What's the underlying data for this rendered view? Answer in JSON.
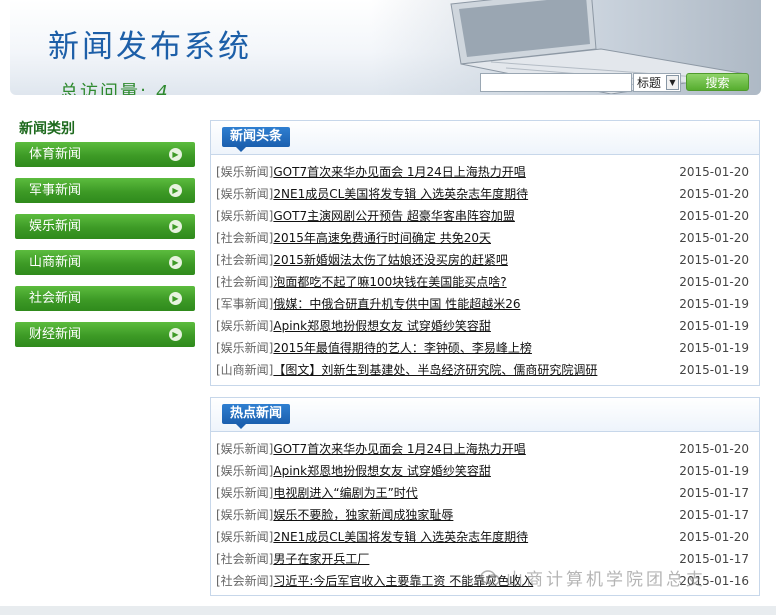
{
  "header": {
    "site_title": "新闻发布系统",
    "visit_label": "总访问量:",
    "visit_count": "4",
    "search_placeholder": "",
    "search_option": "标题",
    "search_button": "搜索"
  },
  "sidebar": {
    "title": "新闻类别",
    "items": [
      {
        "label": "体育新闻"
      },
      {
        "label": "军事新闻"
      },
      {
        "label": "娱乐新闻"
      },
      {
        "label": "山商新闻"
      },
      {
        "label": "社会新闻"
      },
      {
        "label": "财经新闻"
      }
    ]
  },
  "headlines": {
    "title": "新闻头条",
    "rows": [
      {
        "cat": "[娱乐新闻]",
        "title": "GOT7首次来华办见面会 1月24日上海热力开唱",
        "date": "2015-01-20"
      },
      {
        "cat": "[娱乐新闻]",
        "title": "2NE1成员CL美国将发专辑 入选英杂志年度期待",
        "date": "2015-01-20"
      },
      {
        "cat": "[娱乐新闻]",
        "title": "GOT7主演网剧公开预告 超豪华客串阵容加盟",
        "date": "2015-01-20"
      },
      {
        "cat": "[社会新闻]",
        "title": "2015年高速免费通行时间确定 共免20天",
        "date": "2015-01-20"
      },
      {
        "cat": "[社会新闻]",
        "title": "2015新婚姻法太伤了姑娘还没买房的赶紧吧",
        "date": "2015-01-20"
      },
      {
        "cat": "[社会新闻]",
        "title": "泡面都吃不起了嘛100块钱在美国能买点啥?",
        "date": "2015-01-20"
      },
      {
        "cat": "[军事新闻]",
        "title": "俄媒：中俄合研直升机专供中国 性能超越米26",
        "date": "2015-01-19"
      },
      {
        "cat": "[娱乐新闻]",
        "title": "Apink郑恩地扮假想女友 试穿婚纱笑容甜",
        "date": "2015-01-19"
      },
      {
        "cat": "[娱乐新闻]",
        "title": "2015年最值得期待的艺人：李钟硕、李易峰上榜",
        "date": "2015-01-19"
      },
      {
        "cat": "[山商新闻]",
        "title": "【图文】刘新生到基建处、半岛经济研究院、儒商研究院调研",
        "date": "2015-01-19"
      }
    ]
  },
  "hot": {
    "title": "热点新闻",
    "rows": [
      {
        "cat": "[娱乐新闻]",
        "title": "GOT7首次来华办见面会 1月24日上海热力开唱",
        "date": "2015-01-20"
      },
      {
        "cat": "[娱乐新闻]",
        "title": "Apink郑恩地扮假想女友 试穿婚纱笑容甜",
        "date": "2015-01-19"
      },
      {
        "cat": "[娱乐新闻]",
        "title": "电视剧进入“编剧为王”时代",
        "date": "2015-01-17"
      },
      {
        "cat": "[娱乐新闻]",
        "title": "娱乐不要脸，独家新闻成独家耻辱",
        "date": "2015-01-17"
      },
      {
        "cat": "[娱乐新闻]",
        "title": "2NE1成员CL美国将发专辑 入选英杂志年度期待",
        "date": "2015-01-20"
      },
      {
        "cat": "[社会新闻]",
        "title": "男子在家开兵工厂",
        "date": "2015-01-17"
      },
      {
        "cat": "[社会新闻]",
        "title": "习近平:今后军官收入主要靠工资 不能靠灰色收入",
        "date": "2015-01-16"
      }
    ]
  },
  "watermark": "山商计算机学院团总支"
}
